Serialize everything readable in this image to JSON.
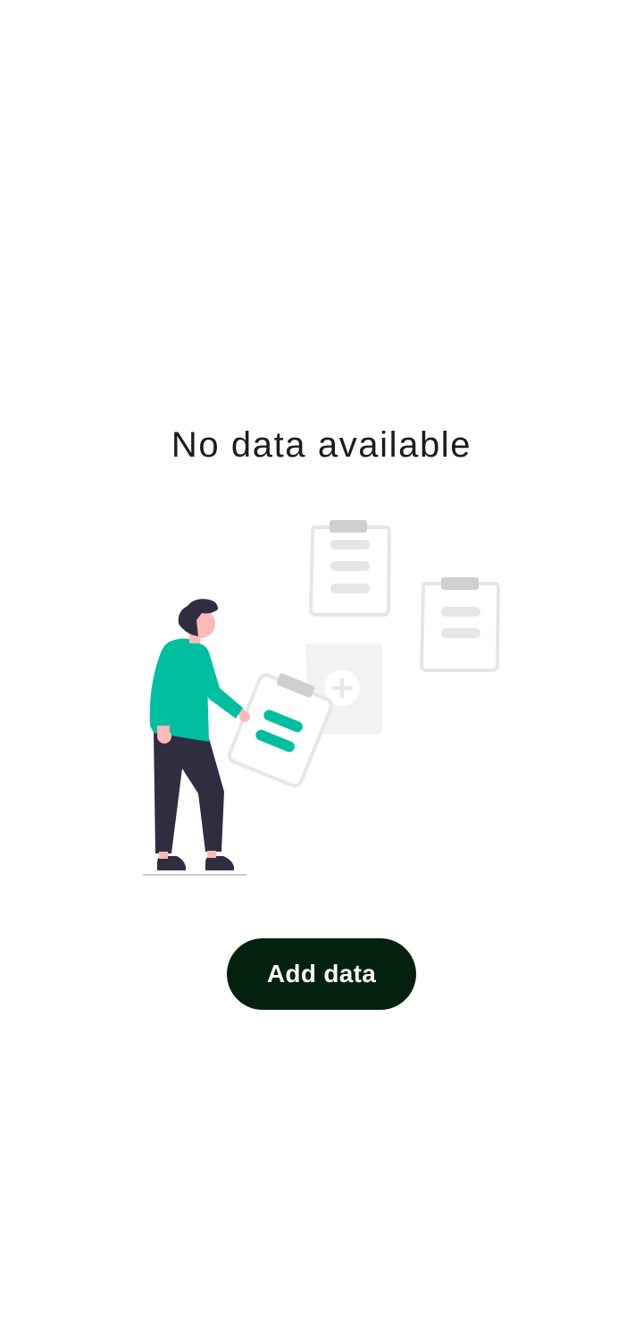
{
  "empty_state": {
    "message": "No data available",
    "illustration": "person-holding-clipboards-illustration",
    "button_label": "Add data"
  },
  "colors": {
    "accent": "#00bfa0",
    "button_bg": "#04200f",
    "button_text": "#ffffff",
    "text": "#1c1c1c"
  }
}
